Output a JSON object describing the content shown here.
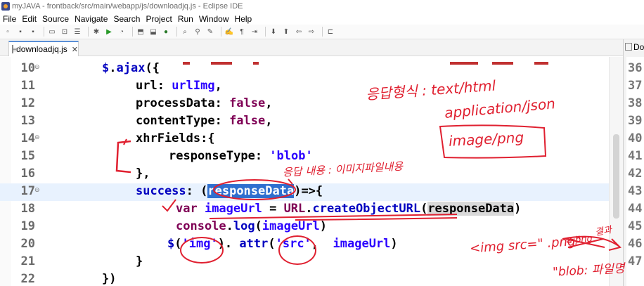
{
  "window": {
    "title": "myJAVA - frontback/src/main/webapp/js/downloadjq.js - Eclipse IDE"
  },
  "menu": [
    "File",
    "Edit",
    "Source",
    "Navigate",
    "Search",
    "Project",
    "Run",
    "Window",
    "Help"
  ],
  "tabs": {
    "active": "downloadjq.js",
    "close": "✕",
    "right": "Dow"
  },
  "editor": {
    "lines": [
      {
        "num": "10",
        "fold": "⊖",
        "tokens": [
          [
            "obj",
            "$"
          ],
          [
            "",
            "."
          ],
          [
            "fn",
            "ajax"
          ],
          [
            "",
            "({"
          ]
        ]
      },
      {
        "num": "11",
        "tokens": [
          [
            "",
            "url: "
          ],
          [
            "idv",
            "urlImg"
          ],
          [
            "",
            ","
          ]
        ]
      },
      {
        "num": "12",
        "tokens": [
          [
            "",
            "processData: "
          ],
          [
            "kw",
            "false"
          ],
          [
            "",
            ","
          ]
        ]
      },
      {
        "num": "13",
        "tokens": [
          [
            "",
            "contentType: "
          ],
          [
            "kw",
            "false"
          ],
          [
            "",
            ","
          ]
        ]
      },
      {
        "num": "14",
        "fold": "⊖",
        "tokens": [
          [
            "",
            "xhrFields:{"
          ]
        ]
      },
      {
        "num": "15",
        "tokens": [
          [
            "",
            "responseType: "
          ],
          [
            "str",
            "'blob'"
          ]
        ]
      },
      {
        "num": "16",
        "tokens": [
          [
            "",
            "},"
          ]
        ]
      },
      {
        "num": "17",
        "fold": "⊖",
        "tokens": [
          [
            "obj",
            "success"
          ],
          [
            "",
            ": ("
          ],
          [
            "sel",
            "responseData"
          ],
          [
            "",
            ")=>{"
          ]
        ]
      },
      {
        "num": "18",
        "tokens": [
          [
            "kw",
            "var "
          ],
          [
            "idv",
            "imageUrl"
          ],
          [
            "",
            " = "
          ],
          [
            "url-obj",
            "URL"
          ],
          [
            "",
            "."
          ],
          [
            "fn",
            "createObjectURL"
          ],
          [
            "",
            "("
          ],
          [
            "hl",
            "responseData"
          ],
          [
            "",
            ")"
          ]
        ]
      },
      {
        "num": "19",
        "tokens": [
          [
            "url-obj",
            "console"
          ],
          [
            "",
            "."
          ],
          [
            "fn",
            "log"
          ],
          [
            "",
            "("
          ],
          [
            "idv",
            "imageUrl"
          ],
          [
            "",
            ")"
          ]
        ]
      },
      {
        "num": "20",
        "tokens": [
          [
            "obj",
            "$"
          ],
          [
            "",
            "("
          ],
          [
            "str",
            "'img'"
          ],
          [
            "",
            "). "
          ],
          [
            "fn",
            "attr"
          ],
          [
            "",
            "("
          ],
          [
            "str",
            "'src'"
          ],
          [
            "",
            ",  "
          ],
          [
            "idv",
            "imageUrl"
          ],
          [
            "",
            ")"
          ]
        ]
      },
      {
        "num": "21",
        "tokens": [
          [
            "",
            "}"
          ]
        ]
      },
      {
        "num": "22",
        "tokens": [
          [
            "",
            "})"
          ]
        ]
      }
    ],
    "right_line_numbers": [
      "36",
      "37",
      "38",
      "39",
      "40",
      "41",
      "42",
      "43",
      "44",
      "45",
      "46",
      "47"
    ]
  },
  "annotations": {
    "response_format": "응답형식 : text/html",
    "json_type": "application/json",
    "image_type": "image/png",
    "response_content": "응답 내용 : 이미지파일내용",
    "img_src": "<img src=\"     .png\"",
    "result": "결과",
    "blob": "\"blob: 파일명",
    "crossed": "     a.png"
  }
}
